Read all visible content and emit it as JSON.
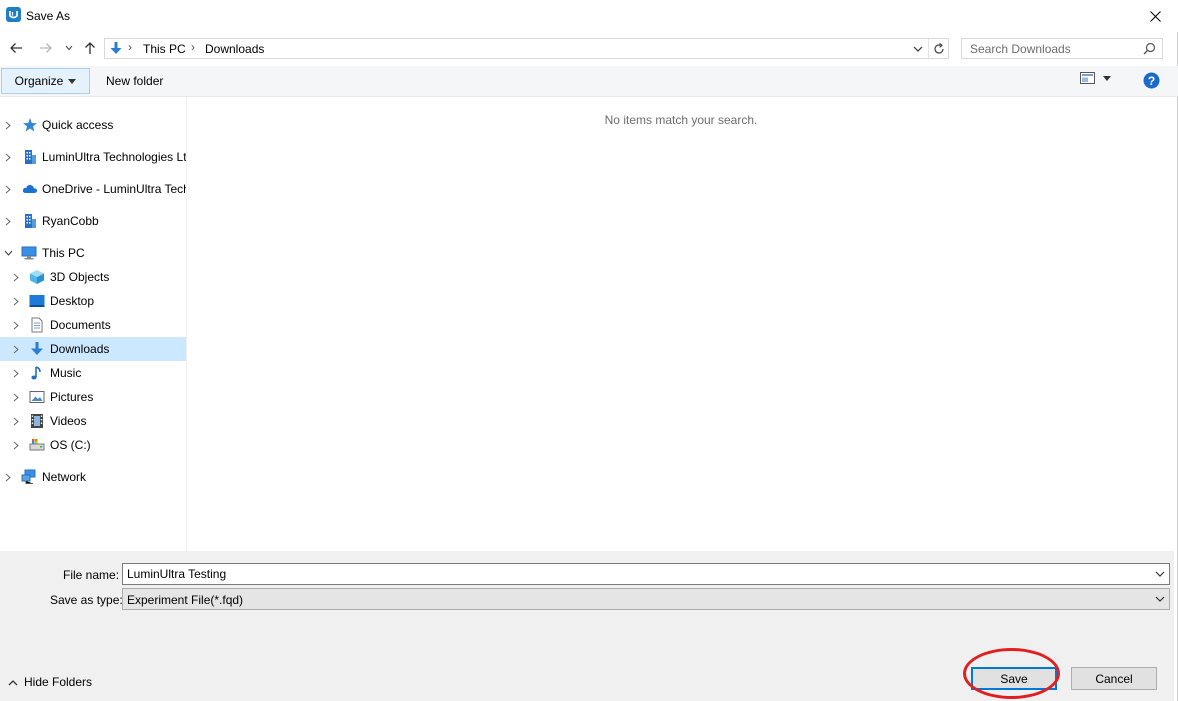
{
  "window": {
    "title": "Save As",
    "icon": "app-icon"
  },
  "nav": {
    "back_icon": "arrow-left-icon",
    "forward_icon": "arrow-right-icon",
    "recent_icon": "chevron-down-icon",
    "up_icon": "arrow-up-icon",
    "breadcrumb": [
      "This PC",
      "Downloads"
    ],
    "separator": "›",
    "refresh_icon": "refresh-icon"
  },
  "search": {
    "placeholder": "Search Downloads",
    "value": ""
  },
  "toolbar": {
    "organize_label": "Organize",
    "new_folder_label": "New folder",
    "view_icon": "view-options-icon",
    "help_icon": "help-icon"
  },
  "tree": {
    "items": [
      {
        "label": "Quick access",
        "icon": "star-icon"
      },
      {
        "label": "LuminUltra Technologies Lt",
        "icon": "building-icon"
      },
      {
        "label": "OneDrive - LuminUltra Tech",
        "icon": "cloud-icon"
      },
      {
        "label": "RyanCobb",
        "icon": "building-icon"
      },
      {
        "label": "This PC",
        "icon": "computer-icon"
      },
      {
        "label": "3D Objects",
        "icon": "cube-icon"
      },
      {
        "label": "Desktop",
        "icon": "desktop-icon"
      },
      {
        "label": "Documents",
        "icon": "document-icon"
      },
      {
        "label": "Downloads",
        "icon": "download-icon"
      },
      {
        "label": "Music",
        "icon": "music-icon"
      },
      {
        "label": "Pictures",
        "icon": "picture-icon"
      },
      {
        "label": "Videos",
        "icon": "video-icon"
      },
      {
        "label": "OS (C:)",
        "icon": "drive-icon"
      },
      {
        "label": "Network",
        "icon": "network-icon"
      }
    ],
    "selected": "Downloads"
  },
  "content": {
    "empty_message": "No items match your search."
  },
  "form": {
    "file_name_label": "File name:",
    "file_name_value": "LuminUltra Testing",
    "save_type_label": "Save as type:",
    "save_type_value": "Experiment File(*.fqd)"
  },
  "footer": {
    "hide_folders_label": "Hide Folders",
    "save_label": "Save",
    "cancel_label": "Cancel"
  },
  "colors": {
    "accent": "#0078d7",
    "selection": "#cce8ff",
    "annotation": "#e02020"
  }
}
